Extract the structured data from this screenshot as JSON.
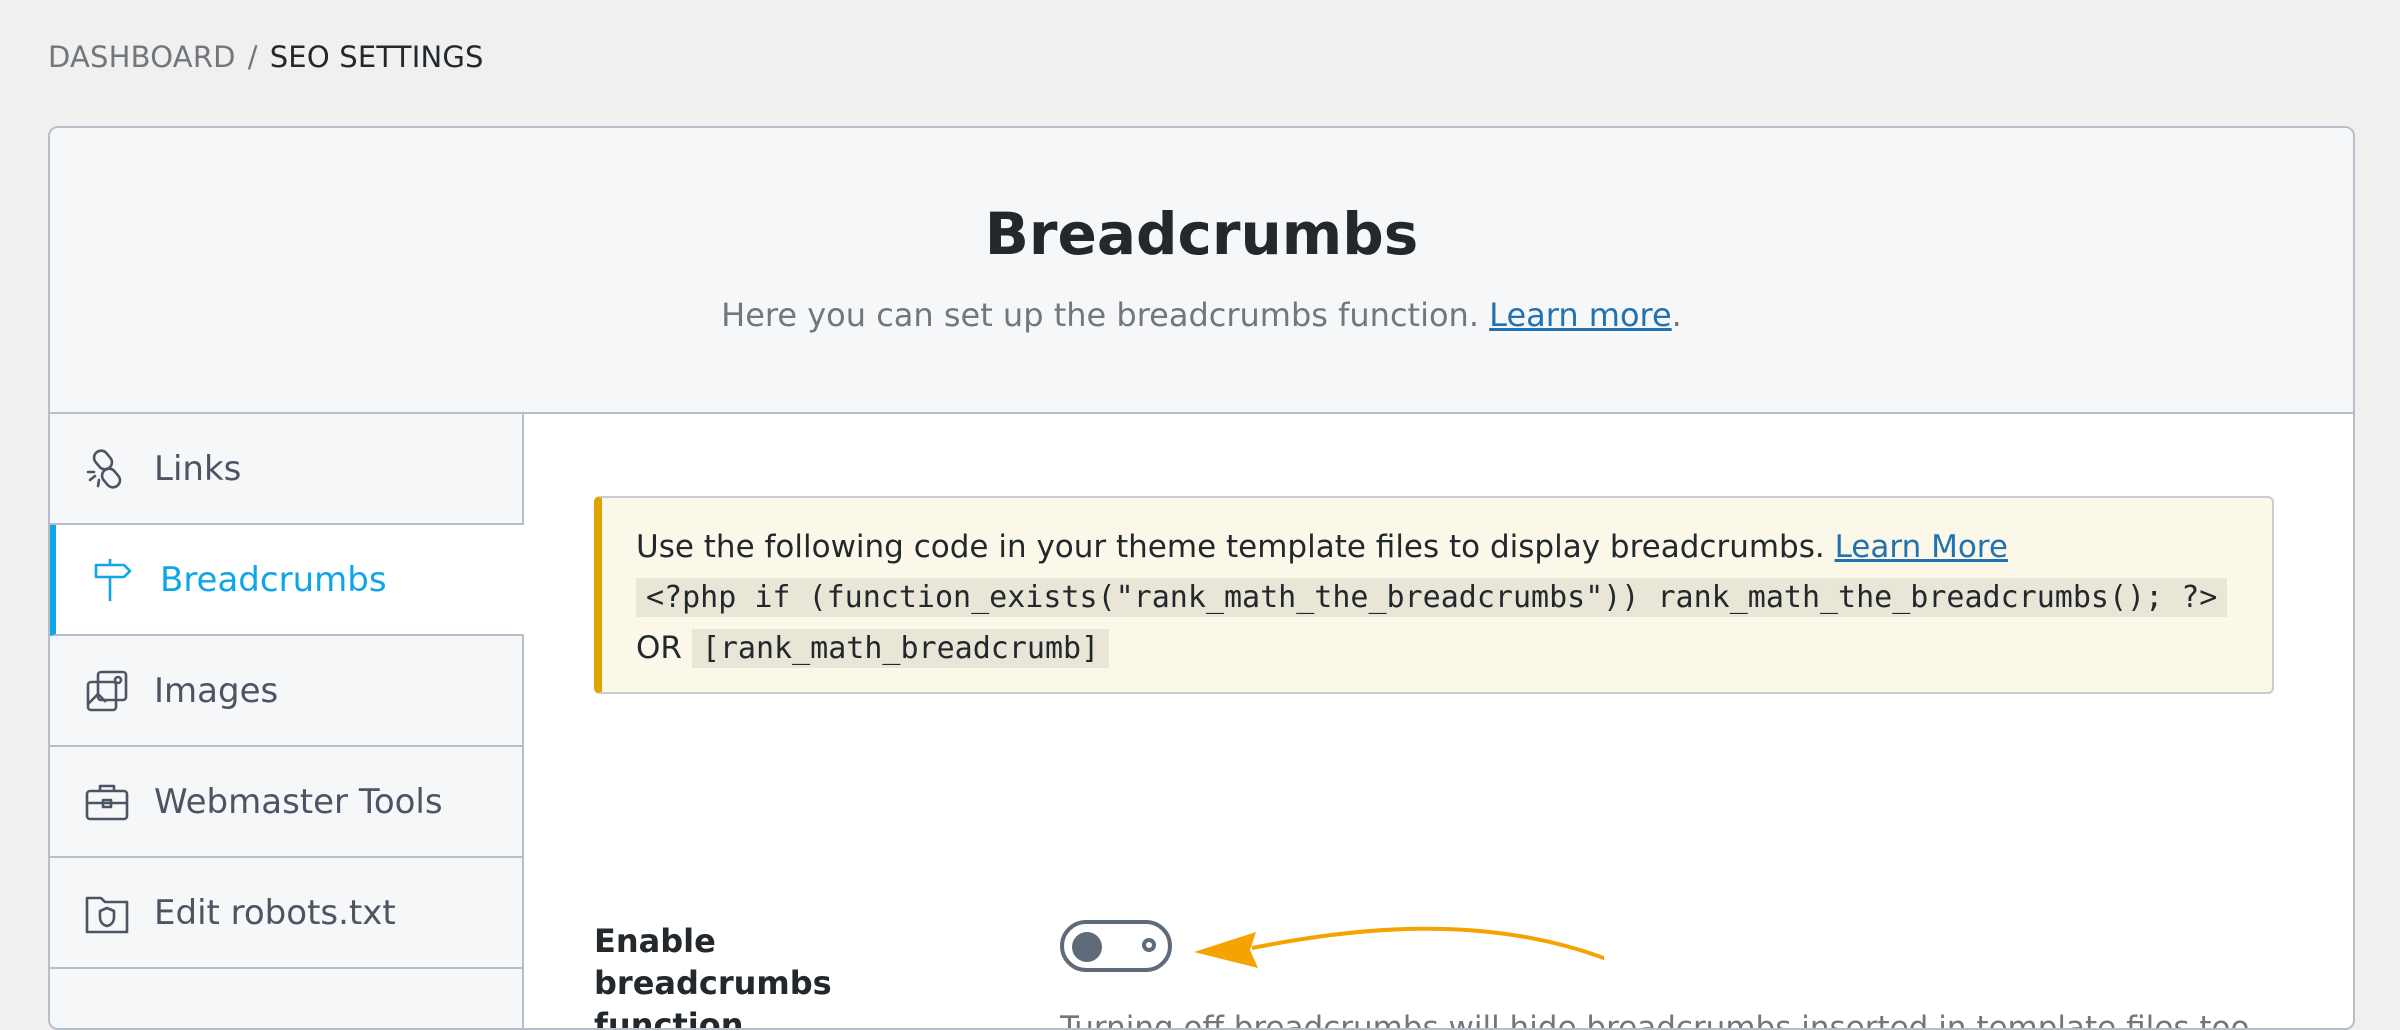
{
  "breadcrumb": {
    "parent": "DASHBOARD",
    "separator": "/",
    "current": "SEO SETTINGS"
  },
  "header": {
    "title": "Breadcrumbs",
    "description": "Here you can set up the breadcrumbs function.",
    "learn_more": "Learn more",
    "period": "."
  },
  "sidebar": {
    "items": [
      {
        "label": "Links",
        "icon": "links-icon",
        "active": false
      },
      {
        "label": "Breadcrumbs",
        "icon": "signpost-icon",
        "active": true
      },
      {
        "label": "Images",
        "icon": "images-icon",
        "active": false
      },
      {
        "label": "Webmaster Tools",
        "icon": "briefcase-icon",
        "active": false
      },
      {
        "label": "Edit robots.txt",
        "icon": "folder-shield-icon",
        "active": false
      }
    ]
  },
  "notice": {
    "text": "Use the following code in your theme template files to display breadcrumbs.",
    "learn_more": "Learn More",
    "code_php": "<?php if (function_exists(\"rank_math_the_breadcrumbs\")) rank_math_the_breadcrumbs(); ?>",
    "or_text": "OR",
    "code_shortcode": "[rank_math_breadcrumb]"
  },
  "setting": {
    "label": "Enable breadcrumbs function",
    "enabled": false,
    "description": "Turning off breadcrumbs will hide breadcrumbs inserted in template files too."
  },
  "colors": {
    "accent": "#0ea5e9",
    "link": "#2271b1",
    "notice_border": "#e0a300",
    "arrow": "#f5a300"
  }
}
